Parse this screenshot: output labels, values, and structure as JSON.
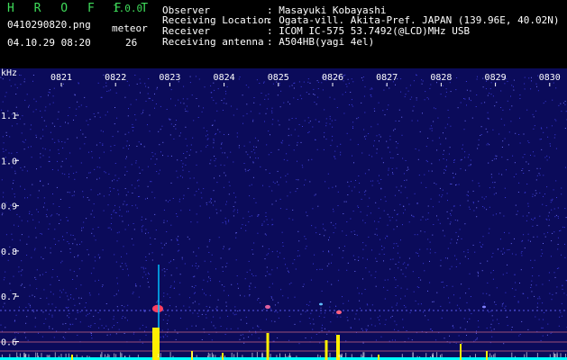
{
  "header": {
    "app_name": "H R O F F T",
    "version": "1.0.0",
    "filename": "0410290820.png",
    "meteor_label": "meteor",
    "timestamp": "04.10.29 08:20",
    "meteor_count": "26"
  },
  "info": [
    {
      "label": "Observer",
      "value": ": Masayuki Kobayashi"
    },
    {
      "label": "Receiving Location",
      "value": ": Ogata-vill. Akita-Pref. JAPAN (139.96E, 40.02N)"
    },
    {
      "label": "Receiver",
      "value": ": ICOM IC-575 53.7492(@LCD)MHz USB"
    },
    {
      "label": "Receiving antenna",
      "value": ": A504HB(yagi 4el)"
    }
  ],
  "axes": {
    "y_unit": "kHz",
    "x_ticks": [
      "0821",
      "0822",
      "0823",
      "0824",
      "0825",
      "0826",
      "0827",
      "0828",
      "0829",
      "0830"
    ],
    "y_ticks": [
      "1.1",
      "1.0",
      "0.9",
      "0.8",
      "0.7",
      "0.6"
    ]
  },
  "colors": {
    "background": "#000000",
    "spectrum_base": "#0b0b5a",
    "noise": "#3a3ad8",
    "header_green": "#3fdc5a",
    "meteor_bar": "#ffee00",
    "baseline": "#00ffff",
    "marker_line": "#c06080",
    "echo": "#ff4060"
  }
}
